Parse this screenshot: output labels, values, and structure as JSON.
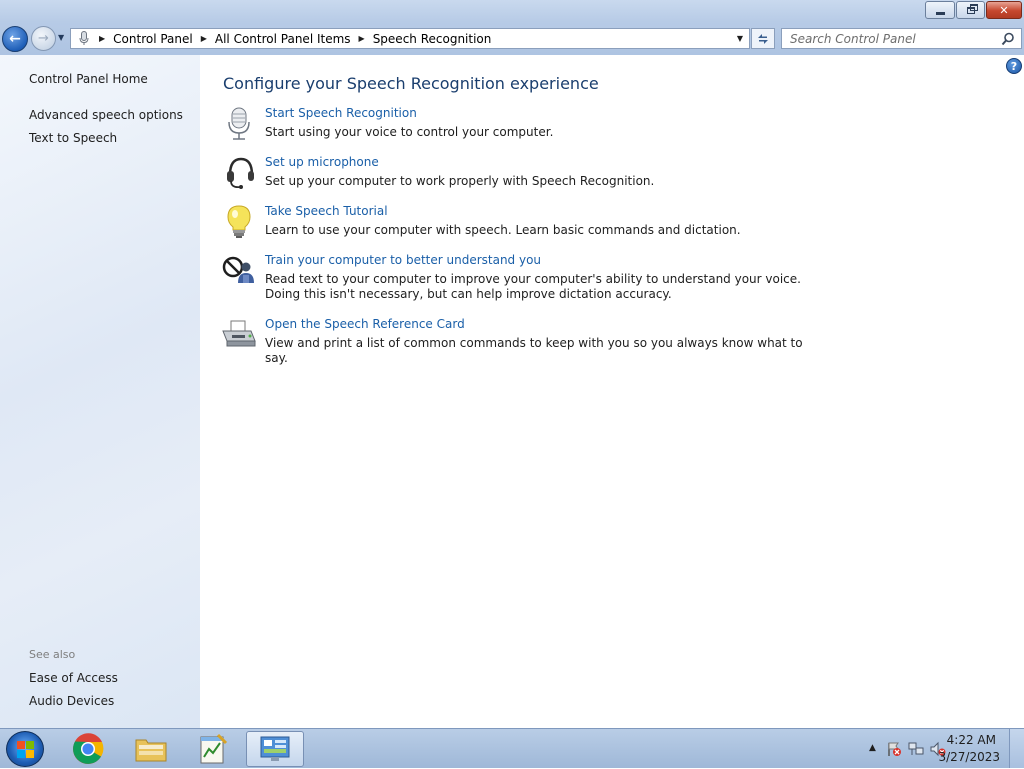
{
  "window": {
    "controls": {
      "minimize": "minimize",
      "maximize": "restore",
      "close": "close"
    }
  },
  "nav": {
    "breadcrumbs": [
      "Control Panel",
      "All Control Panel Items",
      "Speech Recognition"
    ],
    "search_placeholder": "Search Control Panel"
  },
  "sidebar": {
    "home": "Control Panel Home",
    "links": [
      "Advanced speech options",
      "Text to Speech"
    ],
    "see_also_heading": "See also",
    "see_also_links": [
      "Ease of Access",
      "Audio Devices"
    ]
  },
  "main": {
    "title": "Configure your Speech Recognition experience",
    "tasks": [
      {
        "icon": "microphone-icon",
        "link": "Start Speech Recognition",
        "desc": "Start using your voice to control your computer."
      },
      {
        "icon": "headset-icon",
        "link": "Set up microphone",
        "desc": "Set up your computer to work properly with Speech Recognition."
      },
      {
        "icon": "lightbulb-icon",
        "link": "Take Speech Tutorial",
        "desc": "Learn to use your computer with speech.  Learn basic commands and dictation."
      },
      {
        "icon": "train-voice-icon",
        "link": "Train your computer to better understand you",
        "desc": "Read text to your computer to improve your computer's ability to understand your voice.  Doing this isn't necessary, but can help improve dictation accuracy."
      },
      {
        "icon": "printer-icon",
        "link": "Open the Speech Reference Card",
        "desc": "View and print a list of common commands to keep with you so you always know what to say."
      }
    ]
  },
  "taskbar": {
    "apps": [
      "chrome-icon",
      "file-explorer-icon",
      "notepad-icon",
      "control-panel-icon"
    ],
    "clock_time": "4:22 AM",
    "clock_date": "3/27/2023"
  },
  "colors": {
    "link": "#1a5fa8",
    "title": "#1a3e6e",
    "sidebar_bg": "#dfe8f5"
  }
}
